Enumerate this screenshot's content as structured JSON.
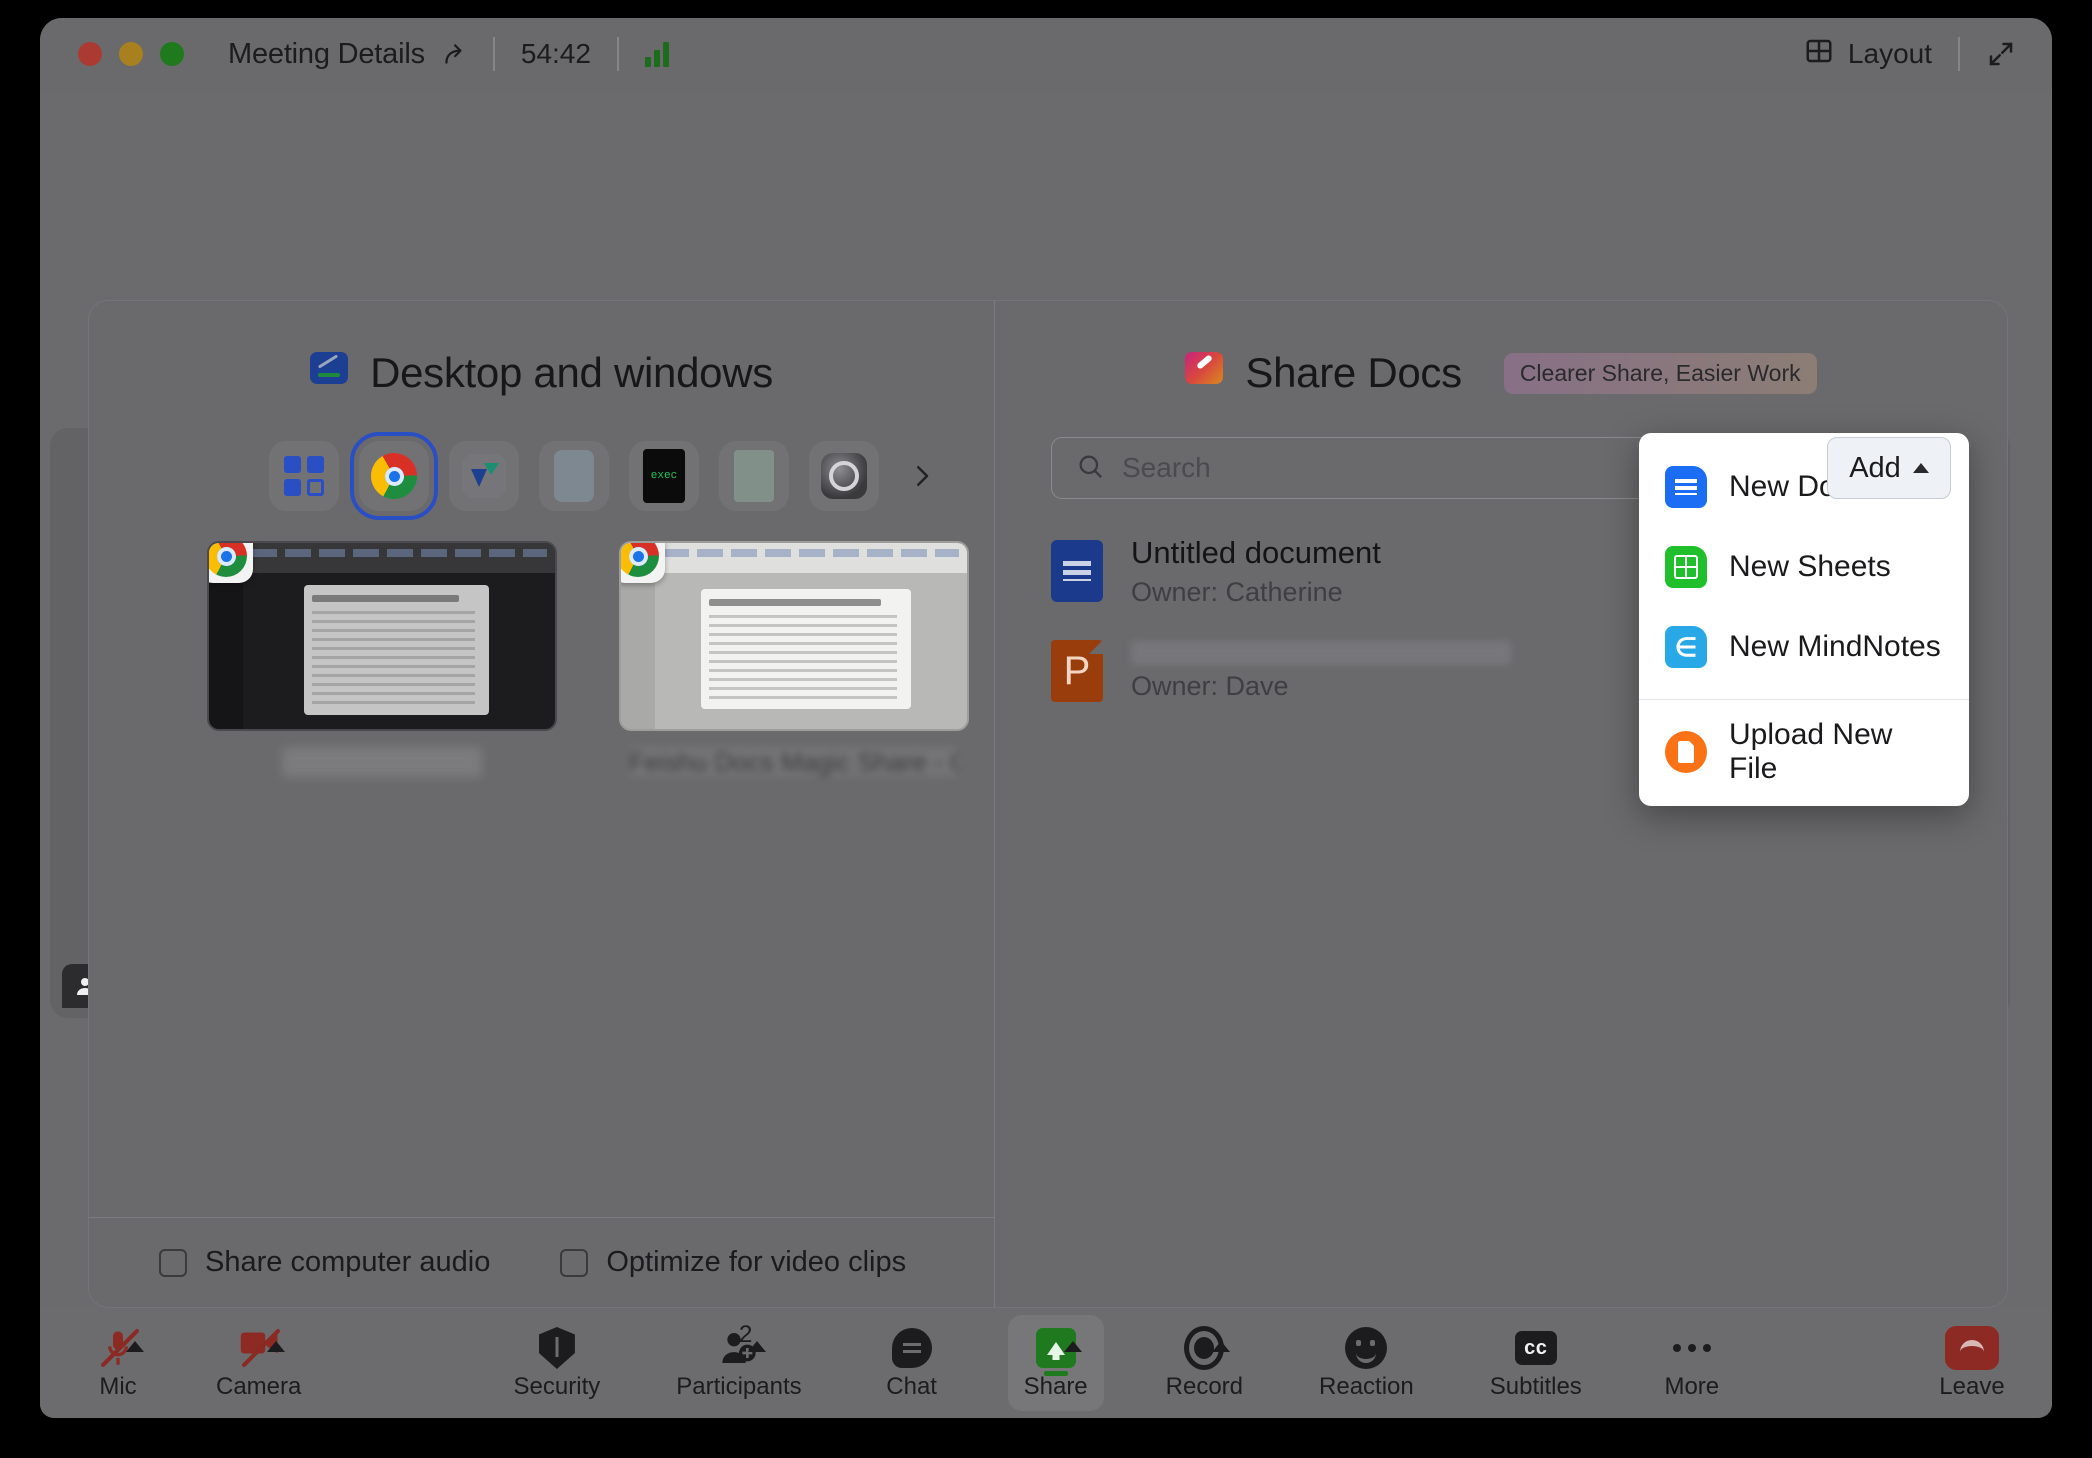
{
  "titlebar": {
    "meeting_title": "Meeting Details",
    "share_icon": "share-arrow-icon",
    "timer": "54:42",
    "signal_icon": "signal-strength-icon",
    "layout_label": "Layout",
    "layout_icon": "layout-grid-icon",
    "fullscreen_icon": "expand-diagonal-icon",
    "traffic_lights": {
      "close": "#ab3a33",
      "minimize": "#a8801f",
      "maximize": "#1e7a1c"
    }
  },
  "desktop_panel": {
    "title": "Desktop and windows",
    "icon": "monitor-share-icon",
    "app_strip": [
      {
        "name": "app-chip-desktop",
        "icon": "grid-squares-icon",
        "selected": false
      },
      {
        "name": "app-chip-chrome",
        "icon": "chrome-icon",
        "selected": true
      },
      {
        "name": "app-chip-lark",
        "icon": "lark-icon",
        "selected": false
      },
      {
        "name": "app-chip-blurred",
        "icon": "app-icon",
        "selected": false
      },
      {
        "name": "app-chip-terminal",
        "icon": "terminal-icon",
        "label": "exec",
        "selected": false
      },
      {
        "name": "app-chip-plain",
        "icon": "app-icon",
        "selected": false
      },
      {
        "name": "app-chip-settings",
        "icon": "gear-icon",
        "selected": false
      }
    ],
    "strip_next_icon": "chevron-right-icon",
    "thumbnails": [
      {
        "badge_icon": "chrome-icon",
        "label": "",
        "theme": "dark"
      },
      {
        "badge_icon": "chrome-icon",
        "label": "Feishu Docs Magic Share - Goo...",
        "theme": "light"
      }
    ],
    "footer": {
      "share_audio_label": "Share computer audio",
      "share_audio_checked": false,
      "optimize_video_label": "Optimize for video clips",
      "optimize_video_checked": false
    }
  },
  "docs_panel": {
    "title": "Share Docs",
    "icon": "magic-wand-share-icon",
    "badge": "Clearer Share, Easier Work",
    "search": {
      "placeholder": "Search",
      "value": "",
      "icon": "search-icon"
    },
    "add_button": {
      "label": "Add",
      "caret_icon": "caret-up-icon"
    },
    "documents": [
      {
        "icon": "google-docs-icon",
        "title": "Untitled document",
        "owner": "Owner: Catherine",
        "redacted": false
      },
      {
        "icon": "powerpoint-icon",
        "title": "",
        "owner": "Owner: Dave",
        "redacted": true
      }
    ],
    "add_menu": [
      {
        "icon": "google-docs-icon",
        "label": "New Docs",
        "separator_after": false
      },
      {
        "icon": "google-sheets-icon",
        "label": "New Sheets",
        "separator_after": false
      },
      {
        "icon": "mindnotes-icon",
        "label": "New MindNotes",
        "separator_after": true
      },
      {
        "icon": "upload-file-icon",
        "label": "Upload New File",
        "separator_after": false
      }
    ]
  },
  "video_tile": {
    "avatar_icon": "person-icon"
  },
  "control_bar": {
    "left": [
      {
        "name": "mic",
        "label": "Mic",
        "icon": "microphone-muted-icon",
        "muted": true,
        "has_chevron": true
      },
      {
        "name": "camera",
        "label": "Camera",
        "icon": "camera-muted-icon",
        "muted": true,
        "has_chevron": true
      }
    ],
    "middle": [
      {
        "name": "security",
        "label": "Security",
        "icon": "shield-icon",
        "has_chevron": false
      },
      {
        "name": "participants",
        "label": "Participants",
        "icon": "participants-add-icon",
        "count": "2",
        "has_chevron": true
      },
      {
        "name": "chat",
        "label": "Chat",
        "icon": "chat-bubble-icon",
        "has_chevron": false
      },
      {
        "name": "share",
        "label": "Share",
        "icon": "share-screen-icon",
        "has_chevron": true,
        "active": true
      },
      {
        "name": "record",
        "label": "Record",
        "icon": "record-circle-icon",
        "has_chevron": true
      },
      {
        "name": "reaction",
        "label": "Reaction",
        "icon": "smiley-face-icon",
        "has_chevron": false
      },
      {
        "name": "subtitles",
        "label": "Subtitles",
        "icon": "closed-caption-icon",
        "has_chevron": false
      },
      {
        "name": "more",
        "label": "More",
        "icon": "ellipsis-icon",
        "has_chevron": false
      }
    ],
    "right": [
      {
        "name": "leave",
        "label": "Leave",
        "icon": "phone-hangup-icon"
      }
    ]
  },
  "colors": {
    "app_background": "#6b6b6d",
    "modal_background": "#6a6a6c",
    "accent_blue": "#2a4fc4",
    "share_green": "#1f7a1f",
    "leave_red": "#8e2a24",
    "menu_background": "#ffffff"
  }
}
